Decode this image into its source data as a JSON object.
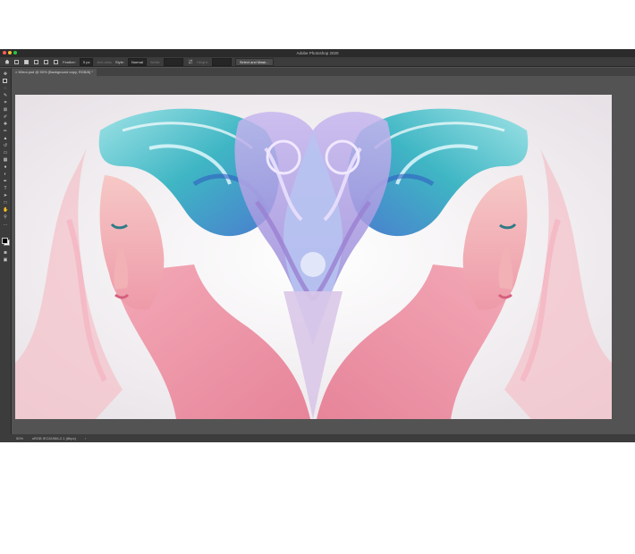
{
  "window": {
    "title": "Adobe Photoshop 2020"
  },
  "options_bar": {
    "feather_label": "Feather:",
    "feather_value": "0 px",
    "antialias_label": "Anti-alias",
    "style_label": "Style:",
    "style_value": "Normal",
    "width_label": "Width:",
    "height_label": "Height:",
    "select_mask_label": "Select and Mask..."
  },
  "document": {
    "tab_title": "Mirror.psd @ 50% (Background copy, RGB/8) *"
  },
  "status": {
    "zoom": "50%",
    "profile": "sRGB IEC61966-2.1 (8bpc)"
  },
  "colors": {
    "ui_dark": "#3c3c3c",
    "ui_mid": "#535353",
    "hair_teal": "#3fb6c4",
    "hair_purple": "#a08ad8",
    "skin_pink": "#ee9aa8"
  }
}
